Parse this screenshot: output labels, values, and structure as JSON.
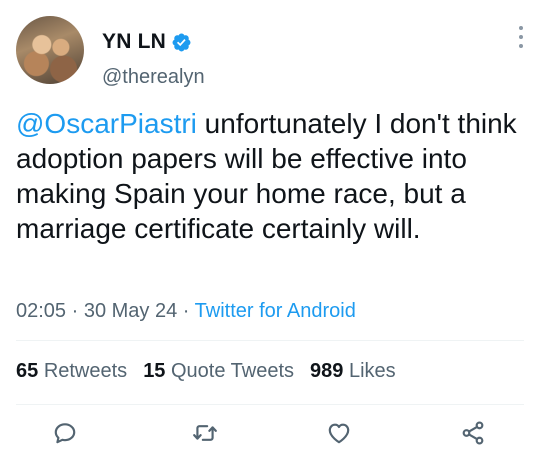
{
  "user": {
    "display_name": "YN LN",
    "handle": "@therealyn",
    "verified": true
  },
  "tweet": {
    "mention": "@OscarPiastri",
    "text": " unfortunately I don't think adoption papers will be effective into making Spain your home race, but a marriage certificate certainly will."
  },
  "meta": {
    "time": "02:05",
    "separator1": " · ",
    "date": "30 May 24",
    "separator2": " · ",
    "source": "Twitter for Android"
  },
  "stats": {
    "retweets_count": "65",
    "retweets_label": "Retweets",
    "quotes_count": "15",
    "quotes_label": "Quote Tweets",
    "likes_count": "989",
    "likes_label": "Likes"
  },
  "icons": {
    "reply": "reply-icon",
    "retweet": "retweet-icon",
    "like": "heart-icon",
    "share": "share-icon",
    "more": "more-vertical-icon",
    "verified": "verified-badge-icon"
  },
  "colors": {
    "accent": "#1d9bf0",
    "text": "#0f1419",
    "secondary": "#536471"
  }
}
